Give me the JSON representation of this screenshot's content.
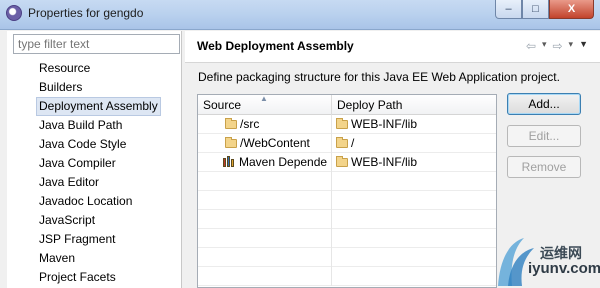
{
  "window": {
    "title": "Properties for gengdo",
    "controls": {
      "minimize": "–",
      "maximize": "□",
      "close": "X"
    }
  },
  "sidebar": {
    "filter_placeholder": "type filter text",
    "items": [
      {
        "label": "Resource"
      },
      {
        "label": "Builders"
      },
      {
        "label": "Deployment Assembly",
        "selected": true
      },
      {
        "label": "Java Build Path"
      },
      {
        "label": "Java Code Style"
      },
      {
        "label": "Java Compiler"
      },
      {
        "label": "Java Editor"
      },
      {
        "label": "Javadoc Location"
      },
      {
        "label": "JavaScript"
      },
      {
        "label": "JSP Fragment"
      },
      {
        "label": "Maven"
      },
      {
        "label": "Project Facets"
      }
    ]
  },
  "page": {
    "title": "Web Deployment Assembly",
    "description": "Define packaging structure for this Java EE Web Application project."
  },
  "table": {
    "headers": {
      "source": "Source",
      "deploy_path": "Deploy Path"
    },
    "rows": [
      {
        "source": "/src",
        "deploy_path": "WEB-INF/lib",
        "icon": "folder-icon"
      },
      {
        "source": "/WebContent",
        "deploy_path": "/",
        "icon": "folder-icon"
      },
      {
        "source": "Maven Depende",
        "deploy_path": "WEB-INF/lib",
        "icon": "library-icon"
      }
    ]
  },
  "buttons": {
    "add": "Add...",
    "edit": "Edit...",
    "remove": "Remove"
  },
  "watermark": {
    "text": "运维网",
    "url": "iyunv.com"
  }
}
